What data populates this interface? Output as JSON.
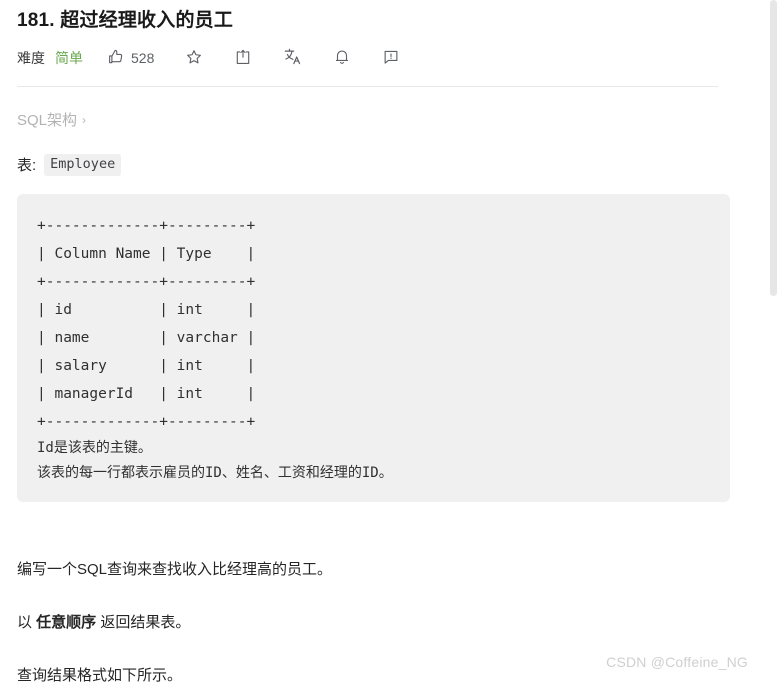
{
  "problem": {
    "number": "181.",
    "title": "超过经理收入的员工",
    "full_title": "181. 超过经理收入的员工"
  },
  "meta": {
    "difficulty_label": "难度",
    "difficulty_value": "简单",
    "difficulty_color": "#6aa84f"
  },
  "toolbar": {
    "items": [
      {
        "name": "thumbs-up",
        "icon": "thumbs-up-icon",
        "count": "528"
      },
      {
        "name": "favorite",
        "icon": "star-icon",
        "count": ""
      },
      {
        "name": "share",
        "icon": "share-icon",
        "count": ""
      },
      {
        "name": "translate",
        "icon": "translate-icon",
        "count": ""
      },
      {
        "name": "notification",
        "icon": "bell-icon",
        "count": ""
      },
      {
        "name": "feedback",
        "icon": "comment-alert-icon",
        "count": ""
      }
    ]
  },
  "breadcrumb": {
    "label": "SQL架构",
    "chevron": "›"
  },
  "table_intro": {
    "prefix": "表:",
    "table_name": "Employee"
  },
  "schema_block": {
    "ascii": "+-------------+---------+\n| Column Name | Type    |\n+-------------+---------+\n| id          | int     |\n| name        | varchar |\n| salary      | int     |\n| managerId   | int     |\n+-------------+---------+",
    "note_line_1": "Id是该表的主键。",
    "note_line_2": "该表的每一行都表示雇员的ID、姓名、工资和经理的ID。"
  },
  "schema_table": {
    "headers": [
      "Column Name",
      "Type"
    ],
    "rows": [
      [
        "id",
        "int"
      ],
      [
        "name",
        "varchar"
      ],
      [
        "salary",
        "int"
      ],
      [
        "managerId",
        "int"
      ]
    ]
  },
  "description": {
    "p1": "编写一个SQL查询来查找收入比经理高的员工。",
    "p2_prefix": "以 ",
    "p2_bold": "任意顺序",
    "p2_suffix": " 返回结果表。",
    "p3": "查询结果格式如下所示。"
  },
  "watermark": {
    "text": "CSDN @Coffeine_NG"
  }
}
